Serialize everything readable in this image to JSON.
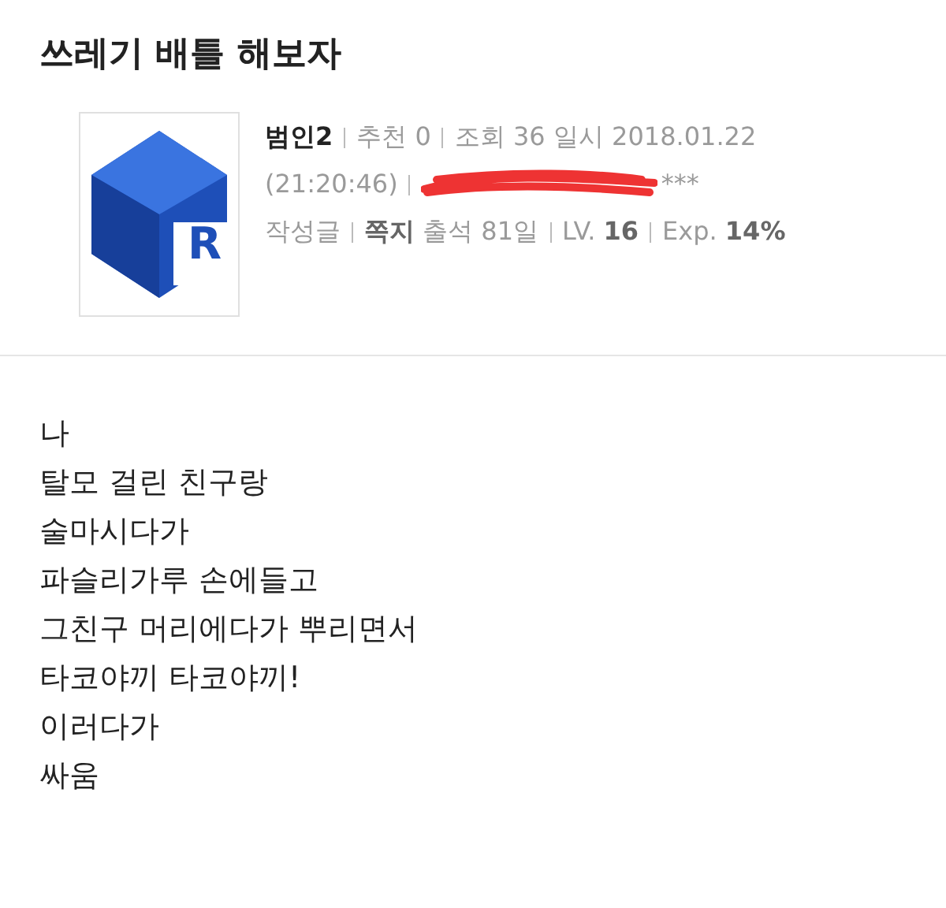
{
  "post": {
    "title": "쓰레기 배틀 해보자"
  },
  "author": {
    "logo_letter": "R",
    "name": "범인2",
    "line1": [
      "추천 0",
      "조회 36 일시 2018.01.22"
    ],
    "time": "(21:20:46)",
    "ip_tail": "***",
    "stats": [
      "작성글",
      "**쪽지** 출석 81일",
      "LV. **16**",
      "Exp. **14%**"
    ]
  },
  "body": [
    "나",
    "탈모 걸린 친구랑",
    "술마시다가",
    "파슬리가루 손에들고",
    "그친구 머리에다가 뿌리면서",
    "타코야끼 타코야끼!",
    "이러다가",
    "싸움"
  ]
}
